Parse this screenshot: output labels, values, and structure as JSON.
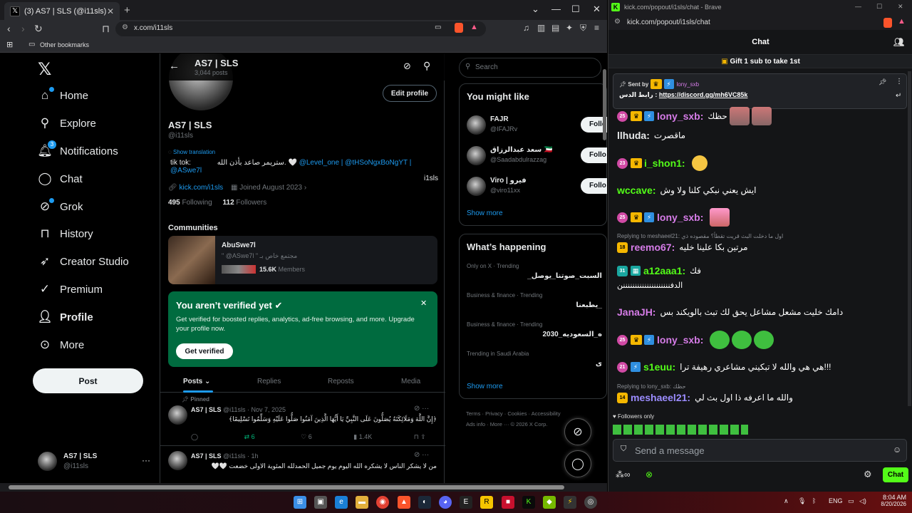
{
  "left_browser": {
    "tab_title": "(3) AS7 | SLS (@i11sls) / X",
    "url": "x.com/i11sls",
    "bookmarks_label": "Other bookmarks"
  },
  "x_nav": {
    "items": [
      {
        "label": "Home"
      },
      {
        "label": "Explore"
      },
      {
        "label": "Notifications",
        "badge": "3"
      },
      {
        "label": "Chat"
      },
      {
        "label": "Grok"
      },
      {
        "label": "History"
      },
      {
        "label": "Creator Studio"
      },
      {
        "label": "Premium"
      },
      {
        "label": "Profile"
      },
      {
        "label": "More"
      }
    ],
    "post_label": "Post",
    "account": {
      "name": "AS7 | SLS",
      "handle": "@i11sls"
    }
  },
  "profile": {
    "header_name": "AS7 | SLS",
    "header_posts": "3,044 posts",
    "name": "AS7 | SLS",
    "handle": "@i11sls",
    "edit_label": "Edit profile",
    "show_translation": "Show translation",
    "bio_prefix": "tik tok:",
    "bio_text": "ستريمر صاعد بأذن الله. 🤍",
    "bio_links": "@Level_one | @tHSoNgxBoNgYT | @ASwe7l",
    "bio_suffix": "i1sls",
    "link": "kick.com/i1sls",
    "joined": "Joined August 2023",
    "following_count": "495",
    "following_label": "Following",
    "followers_count": "112",
    "followers_label": "Followers"
  },
  "communities": {
    "title": "Communities",
    "name": "AbuSwe7l",
    "desc": "\" @ASwe7l \" مجتمع خاص بـ",
    "members_count": "15.6K",
    "members_label": "Members"
  },
  "verify": {
    "title": "You aren’t verified yet",
    "text": "Get verified for boosted replies, analytics, ad-free browsing, and more. Upgrade your profile now.",
    "button": "Get verified"
  },
  "profile_tabs": [
    "Posts",
    "Replies",
    "Reposts",
    "Media"
  ],
  "tweets": [
    {
      "pinned_label": "Pinned",
      "name": "AS7 | SLS",
      "meta": "@i11sls · Nov 7, 2025",
      "text": "﴿إِنَّ اللَّهَ وَمَلَائِكَتَهُ يُصَلُّونَ عَلَى النَّبِيِّ يَا أَيُّهَا الَّذِينَ آمَنُوا صَلُّوا عَلَيْهِ وَسَلِّمُوا تَسْلِيمًا﴾",
      "reposts": "6",
      "likes": "6",
      "views": "1.4K"
    },
    {
      "name": "AS7 | SLS",
      "meta": "@i11sls · 1h",
      "text": "من لا يشكر الناس لا يشكره الله اليوم يوم جميل الحمدلله المئوية الاولى خضعت 🤍🤍"
    }
  ],
  "right_col": {
    "search_placeholder": "Search",
    "might_like_title": "You might like",
    "suggestions": [
      {
        "name": "FAJR",
        "handle": "@IFAJRv",
        "follow": "Follo"
      },
      {
        "name": "سعد عبدالرزاق 🇰🇼",
        "handle": "@Saadabdulrazzag",
        "follow": "Follo"
      },
      {
        "name": "Viro | فيرو",
        "handle": "@viro11xx",
        "follow": "Follo"
      }
    ],
    "show_more": "Show more",
    "happening_title": "What’s happening",
    "trends": [
      {
        "context": "Only on X · Trending",
        "topic": "السبت_صوتنا_يوصل_"
      },
      {
        "context": "Business & finance · Trending",
        "topic": "_يطبعنا"
      },
      {
        "context": "Business & finance · Trending",
        "topic": "ه_السعوديه_2030"
      },
      {
        "context": "Trending in Saudi Arabia",
        "topic": "ى"
      }
    ],
    "show_more2": "Show more",
    "footer": [
      "Terms",
      "Privacy",
      "Cookies",
      "Accessibility",
      "Ads info",
      "More ···",
      "© 2026 X Corp."
    ]
  },
  "kick": {
    "window_title": "kick.com/popout/i1sls/chat - Brave",
    "url": "kick.com/popout/i1sls/chat",
    "header": "Chat",
    "gift": "Gift 1 sub to take 1st",
    "pinned_sent_by": "Sent by",
    "pinned_user": "lony_sxb",
    "pinned_label": "رابط الدس :",
    "pinned_link": "https://discord.gg/mh6VC85k",
    "messages": [
      {
        "level": "25",
        "user": "lony_sxb:",
        "text": "حظك",
        "color": "#d67ce8"
      },
      {
        "user": "llhuda:",
        "text": "ماقصرت",
        "color": "#e7e9ea"
      },
      {
        "level": "23",
        "user": "i_shon1:",
        "text": "",
        "color": "#53fc18"
      },
      {
        "user": "wccave:",
        "text": "ايش يعني نبكي كلنا ولا وش",
        "color": "#53fc18"
      },
      {
        "level": "25",
        "user": "lony_sxb:",
        "text": "",
        "color": "#d67ce8"
      },
      {
        "reply": "Replying to meshaeel21: اول ما دخلت البث قريت تقطأ؟ مقصوده ذي",
        "level": "18",
        "user": "reemo67:",
        "text": "مرتين بكا علينا خليه",
        "color": "#d67ce8"
      },
      {
        "level": "31",
        "user": "a12aaa1:",
        "text": "فك",
        "text2": "الدفننننننننننننننننننننن",
        "color": "#53fc18"
      },
      {
        "user": "JanaJH:",
        "text": "دامك خليت مشعل مشاعل يحق لك تبث بالويكند بس",
        "color": "#d67ce8"
      },
      {
        "level": "25",
        "user": "lony_sxb:",
        "text": "",
        "color": "#d67ce8"
      },
      {
        "level": "21",
        "user": "s1euu:",
        "text": "هي هي والله لا تبكيني مشاعري رهيفة ترا!!!",
        "color": "#53fc18"
      },
      {
        "reply": "Replying to lony_sxb: حظك",
        "level": "14",
        "user": "meshaeel21:",
        "text": "والله ما اعرفه ذا اول بث لي",
        "color": "#9b8cff"
      }
    ],
    "followers_only": "Followers only",
    "input_placeholder": "Send a message",
    "chat_button": "Chat"
  },
  "taskbar": {
    "lang": "ENG",
    "time": "8:04 AM",
    "date": "8/20/2026"
  },
  "colors": {
    "x_blue": "#1d9bf0",
    "kick_green": "#53fc18",
    "verify_green": "#006b3f"
  }
}
